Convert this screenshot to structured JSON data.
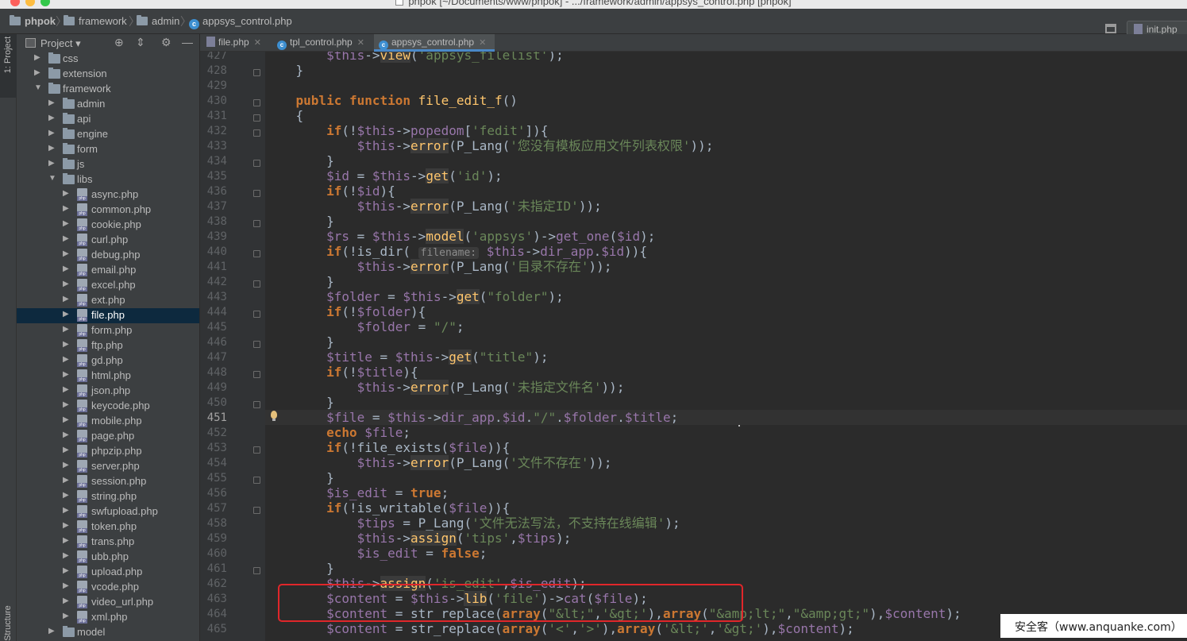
{
  "window": {
    "title": "phpok [~/Documents/www/phpok] - .../framework/admin/appsys_control.php [phpok]"
  },
  "navbar": {
    "crumbs": [
      "phpok",
      "framework",
      "admin",
      "appsys_control.php"
    ],
    "run_config": "init.php"
  },
  "side_tabs": {
    "project": "1: Project",
    "structure": "Z: Structure"
  },
  "project_panel": {
    "title": "Project"
  },
  "tree": [
    {
      "label": "css",
      "kind": "folder",
      "depth": 1,
      "expanded": false
    },
    {
      "label": "extension",
      "kind": "folder",
      "depth": 1,
      "expanded": false
    },
    {
      "label": "framework",
      "kind": "folder",
      "depth": 1,
      "expanded": true
    },
    {
      "label": "admin",
      "kind": "folder",
      "depth": 2,
      "expanded": false
    },
    {
      "label": "api",
      "kind": "folder",
      "depth": 2,
      "expanded": false
    },
    {
      "label": "engine",
      "kind": "folder",
      "depth": 2,
      "expanded": false
    },
    {
      "label": "form",
      "kind": "folder",
      "depth": 2,
      "expanded": false
    },
    {
      "label": "js",
      "kind": "folder",
      "depth": 2,
      "expanded": false
    },
    {
      "label": "libs",
      "kind": "folder",
      "depth": 2,
      "expanded": true
    },
    {
      "label": "async.php",
      "kind": "php",
      "depth": 3
    },
    {
      "label": "common.php",
      "kind": "php",
      "depth": 3
    },
    {
      "label": "cookie.php",
      "kind": "php",
      "depth": 3
    },
    {
      "label": "curl.php",
      "kind": "php",
      "depth": 3
    },
    {
      "label": "debug.php",
      "kind": "php",
      "depth": 3
    },
    {
      "label": "email.php",
      "kind": "php",
      "depth": 3
    },
    {
      "label": "excel.php",
      "kind": "php",
      "depth": 3
    },
    {
      "label": "ext.php",
      "kind": "php",
      "depth": 3
    },
    {
      "label": "file.php",
      "kind": "php",
      "depth": 3,
      "selected": true
    },
    {
      "label": "form.php",
      "kind": "php",
      "depth": 3
    },
    {
      "label": "ftp.php",
      "kind": "php",
      "depth": 3
    },
    {
      "label": "gd.php",
      "kind": "php",
      "depth": 3
    },
    {
      "label": "html.php",
      "kind": "php",
      "depth": 3
    },
    {
      "label": "json.php",
      "kind": "php",
      "depth": 3
    },
    {
      "label": "keycode.php",
      "kind": "php",
      "depth": 3
    },
    {
      "label": "mobile.php",
      "kind": "php",
      "depth": 3
    },
    {
      "label": "page.php",
      "kind": "php",
      "depth": 3
    },
    {
      "label": "phpzip.php",
      "kind": "php",
      "depth": 3
    },
    {
      "label": "server.php",
      "kind": "php",
      "depth": 3
    },
    {
      "label": "session.php",
      "kind": "php",
      "depth": 3
    },
    {
      "label": "string.php",
      "kind": "php",
      "depth": 3
    },
    {
      "label": "swfupload.php",
      "kind": "php",
      "depth": 3
    },
    {
      "label": "token.php",
      "kind": "php",
      "depth": 3
    },
    {
      "label": "trans.php",
      "kind": "php",
      "depth": 3
    },
    {
      "label": "ubb.php",
      "kind": "php",
      "depth": 3
    },
    {
      "label": "upload.php",
      "kind": "php",
      "depth": 3
    },
    {
      "label": "vcode.php",
      "kind": "php",
      "depth": 3
    },
    {
      "label": "video_url.php",
      "kind": "php",
      "depth": 3
    },
    {
      "label": "xml.php",
      "kind": "php",
      "depth": 3
    },
    {
      "label": "model",
      "kind": "folder",
      "depth": 2,
      "expanded": false
    }
  ],
  "tabs": [
    {
      "label": "file.php",
      "icon": "php-file-icon",
      "active": false
    },
    {
      "label": "tpl_control.php",
      "icon": "class-icon",
      "active": false
    },
    {
      "label": "appsys_control.php",
      "icon": "class-icon",
      "active": true
    }
  ],
  "editor": {
    "current_line": "451",
    "line_numbers": [
      "427",
      "428",
      "429",
      "430",
      "431",
      "432",
      "433",
      "434",
      "435",
      "436",
      "437",
      "438",
      "439",
      "440",
      "441",
      "442",
      "443",
      "444",
      "445",
      "446",
      "447",
      "448",
      "449",
      "450",
      "451",
      "452",
      "453",
      "454",
      "455",
      "456",
      "457",
      "458",
      "459",
      "460",
      "461",
      "462",
      "463",
      "464",
      "465"
    ],
    "code": [
      "        $this->view('appsys_filelist');",
      "    }",
      "",
      "    public function file_edit_f()",
      "    {",
      "        if(!$this->popedom['fedit']){",
      "            $this->error(P_Lang('您没有模板应用文件列表权限'));",
      "        }",
      "        $id = $this->get('id');",
      "        if(!$id){",
      "            $this->error(P_Lang('未指定ID'));",
      "        }",
      "        $rs = $this->model('appsys')->get_one($id);",
      "        if(!is_dir( filename: $this->dir_app.$id)){",
      "            $this->error(P_Lang('目录不存在'));",
      "        }",
      "        $folder = $this->get(\"folder\");",
      "        if(!$folder){",
      "            $folder = \"/\";",
      "        }",
      "        $title = $this->get(\"title\");",
      "        if(!$title){",
      "            $this->error(P_Lang('未指定文件名'));",
      "        }",
      "        $file = $this->dir_app.$id.\"/\".$folder.$title;",
      "        echo $file;",
      "        if(!file_exists($file)){",
      "            $this->error(P_Lang('文件不存在'));",
      "        }",
      "        $is_edit = true;",
      "        if(!is_writable($file)){",
      "            $tips = P_Lang('文件无法写法，不支持在线编辑');",
      "            $this->assign('tips',$tips);",
      "            $is_edit = false;",
      "        }",
      "        $this->assign('is_edit',$is_edit);",
      "        $content = $this->lib('file')->cat($file);",
      "        $content = str_replace(array(\"&lt;\",'&gt;'),array(\"&amp;lt;\",\"&amp;gt;\"),$content);",
      "        $content = str_replace(array('<','>'),array('&lt;','&gt;'),$content);"
    ]
  },
  "watermark": "安全客（www.anquanke.com）",
  "colors": {
    "keyword": "#cc7832",
    "variable": "#9876aa",
    "string": "#6a8759",
    "function": "#ffc66d",
    "annotation_box": "#e0262a",
    "selection": "#0d293e"
  }
}
